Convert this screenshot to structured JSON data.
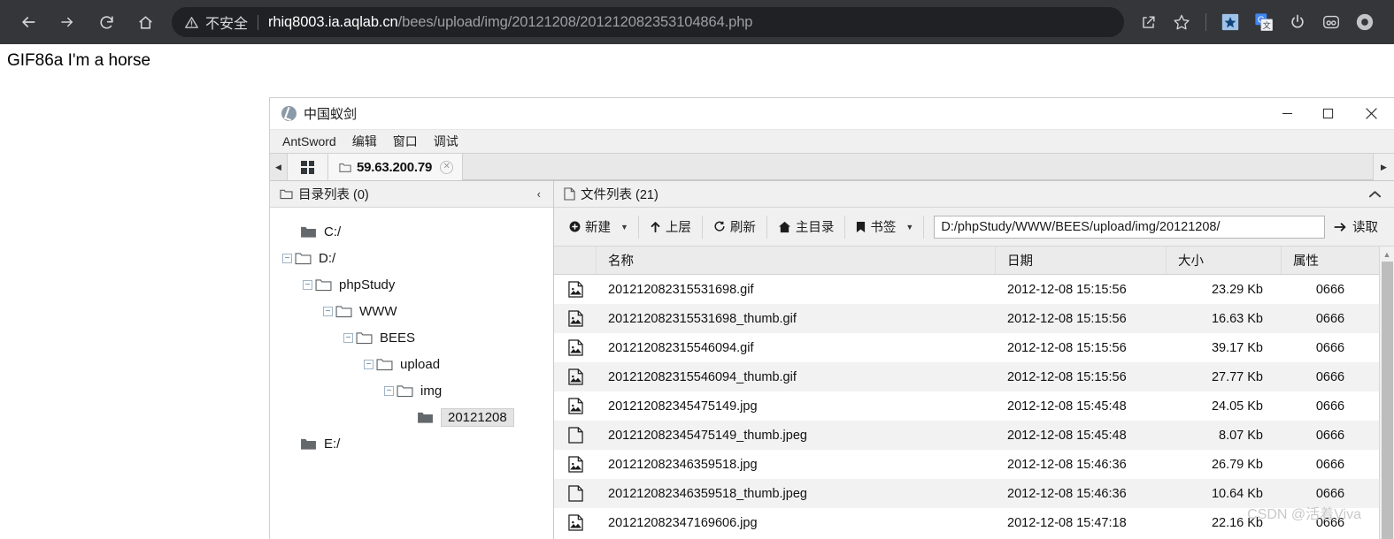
{
  "browser": {
    "nav": {
      "back": "back-arrow",
      "forward": "forward-arrow",
      "reload": "reload",
      "home": "home"
    },
    "security_label": "不安全",
    "url_host": "rhiq8003.ia.aqlab.cn",
    "url_path": "/bees/upload/img/20121208/201212082353104864.php",
    "actions": [
      "share-icon",
      "bookmark-star-icon"
    ],
    "extensions": [
      "blue-star-extension-icon",
      "google-translate-icon",
      "power-icon",
      "lastpass-icon",
      "profile-avatar-icon"
    ]
  },
  "page": {
    "content_text": "GIF86a I'm a horse"
  },
  "app": {
    "title": "中国蚁剑",
    "menus": [
      "AntSword",
      "编辑",
      "窗口",
      "调试"
    ],
    "window_controls": {
      "minimize": "–",
      "maximize": "☐",
      "close": "✕"
    },
    "tab": {
      "label": "59.63.200.79",
      "close": "✕"
    },
    "dir_panel": {
      "title": "目录列表 (0)",
      "collapse": "‹",
      "tree": [
        {
          "label": "C:/",
          "depth": 0,
          "expander": "",
          "open": false,
          "selected": false
        },
        {
          "label": "D:/",
          "depth": 0,
          "expander": "−",
          "open": true,
          "selected": false
        },
        {
          "label": "phpStudy",
          "depth": 1,
          "expander": "−",
          "open": true,
          "selected": false
        },
        {
          "label": "WWW",
          "depth": 2,
          "expander": "−",
          "open": true,
          "selected": false
        },
        {
          "label": "BEES",
          "depth": 3,
          "expander": "−",
          "open": true,
          "selected": false
        },
        {
          "label": "upload",
          "depth": 4,
          "expander": "−",
          "open": true,
          "selected": false
        },
        {
          "label": "img",
          "depth": 5,
          "expander": "−",
          "open": true,
          "selected": false
        },
        {
          "label": "20121208",
          "depth": 6,
          "expander": "",
          "open": false,
          "selected": true
        },
        {
          "label": "E:/",
          "depth": 0,
          "expander": "",
          "open": false,
          "selected": false
        }
      ]
    },
    "file_panel": {
      "title": "文件列表 (21)",
      "collapse": "^",
      "toolbar": {
        "new": "新建",
        "up": "上层",
        "refresh": "刷新",
        "home": "主目录",
        "bookmark": "书签",
        "caret": "▼",
        "path_value": "D:/phpStudy/WWW/BEES/upload/img/20121208/",
        "path_placeholder": "",
        "read": "读取"
      },
      "columns": [
        "名称",
        "日期",
        "大小",
        "属性"
      ],
      "rows": [
        {
          "icon": "image-file-icon",
          "name": "201212082315531698.gif",
          "date": "2012-12-08 15:15:56",
          "size": "23.29 Kb",
          "attr": "0666"
        },
        {
          "icon": "image-file-icon",
          "name": "201212082315531698_thumb.gif",
          "date": "2012-12-08 15:15:56",
          "size": "16.63 Kb",
          "attr": "0666"
        },
        {
          "icon": "image-file-icon",
          "name": "201212082315546094.gif",
          "date": "2012-12-08 15:15:56",
          "size": "39.17 Kb",
          "attr": "0666"
        },
        {
          "icon": "image-file-icon",
          "name": "201212082315546094_thumb.gif",
          "date": "2012-12-08 15:15:56",
          "size": "27.77 Kb",
          "attr": "0666"
        },
        {
          "icon": "image-file-icon",
          "name": "201212082345475149.jpg",
          "date": "2012-12-08 15:45:48",
          "size": "24.05 Kb",
          "attr": "0666"
        },
        {
          "icon": "blank-file-icon",
          "name": "201212082345475149_thumb.jpeg",
          "date": "2012-12-08 15:45:48",
          "size": "8.07 Kb",
          "attr": "0666"
        },
        {
          "icon": "image-file-icon",
          "name": "201212082346359518.jpg",
          "date": "2012-12-08 15:46:36",
          "size": "26.79 Kb",
          "attr": "0666"
        },
        {
          "icon": "blank-file-icon",
          "name": "201212082346359518_thumb.jpeg",
          "date": "2012-12-08 15:46:36",
          "size": "10.64 Kb",
          "attr": "0666"
        },
        {
          "icon": "image-file-icon",
          "name": "201212082347169606.jpg",
          "date": "2012-12-08 15:47:18",
          "size": "22.16 Kb",
          "attr": "0666"
        }
      ]
    }
  },
  "watermark": "CSDN @活着Viva"
}
